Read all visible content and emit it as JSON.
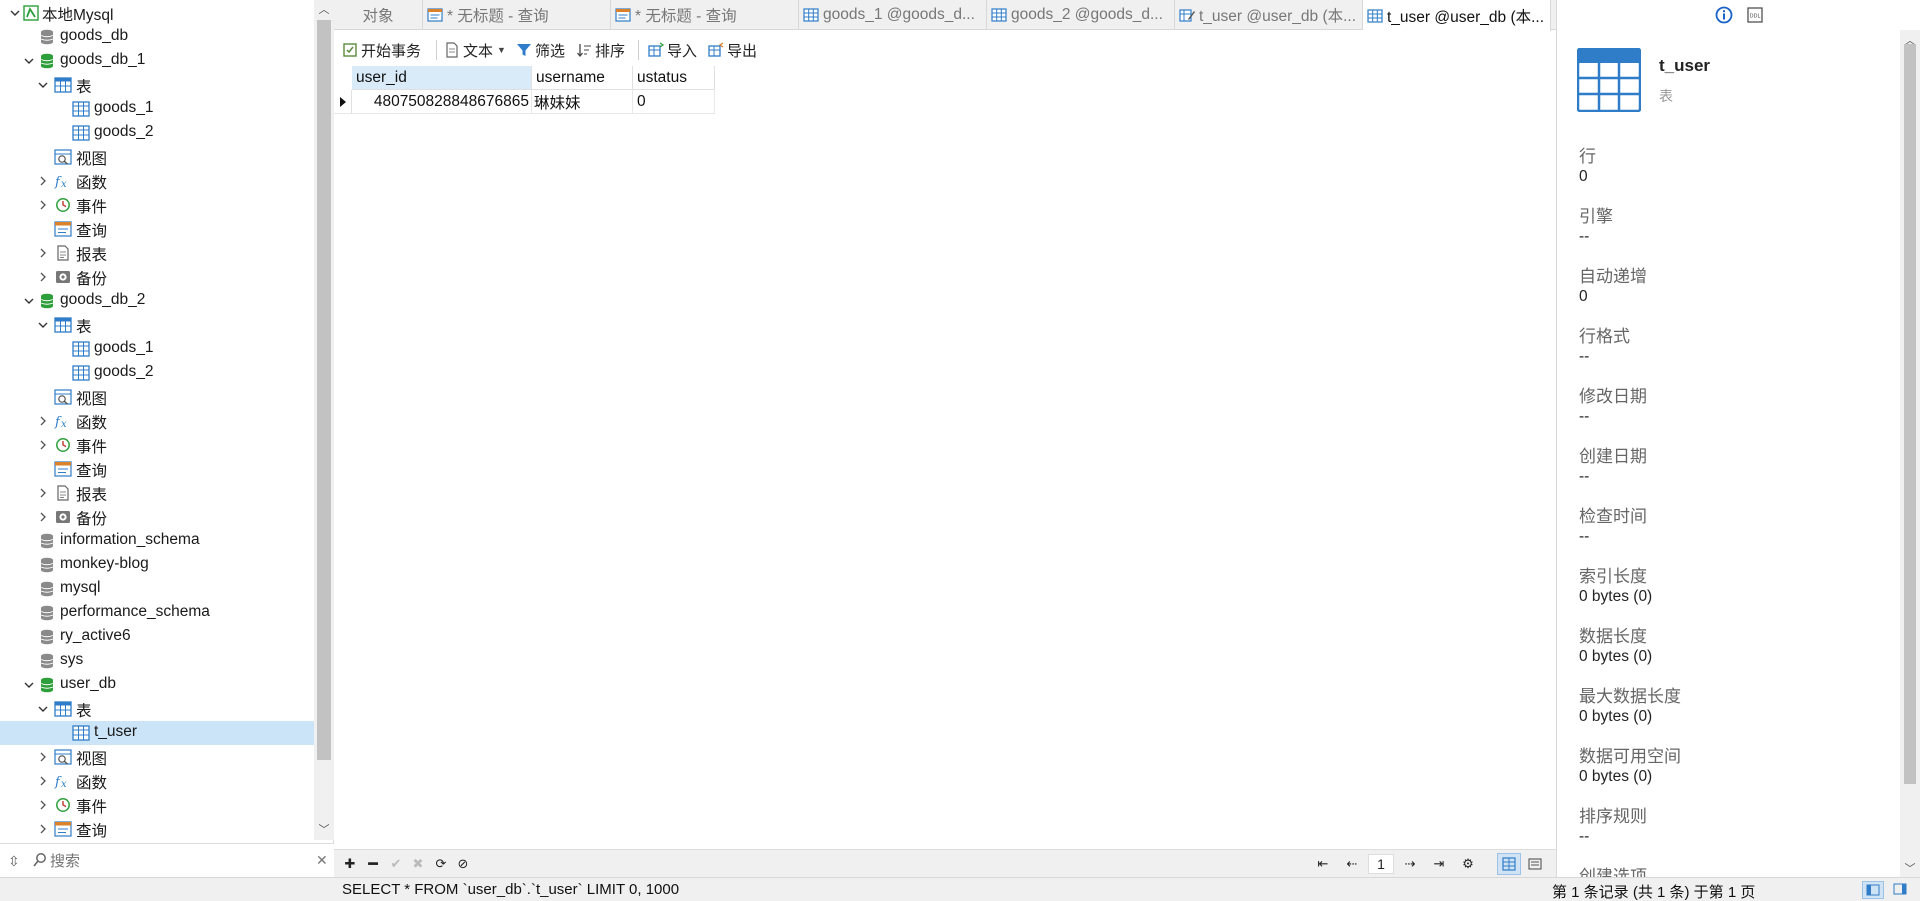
{
  "tree": {
    "nodes": [
      {
        "label": "本地Mysql",
        "level": 0,
        "expanded": true,
        "icon": "connection-icon",
        "chevron": "down"
      },
      {
        "label": "goods_db",
        "level": 1,
        "icon": "database-gray-icon",
        "chevron": "none"
      },
      {
        "label": "goods_db_1",
        "level": 1,
        "icon": "database-green-icon",
        "chevron": "down"
      },
      {
        "label": "表",
        "level": 2,
        "icon": "tables-folder-icon",
        "chevron": "down"
      },
      {
        "label": "goods_1",
        "level": 3,
        "icon": "table-icon",
        "chevron": "none"
      },
      {
        "label": "goods_2",
        "level": 3,
        "icon": "table-icon",
        "chevron": "none"
      },
      {
        "label": "视图",
        "level": 2,
        "icon": "view-icon",
        "chevron": "none"
      },
      {
        "label": "函数",
        "level": 2,
        "icon": "function-icon",
        "chevron": "right"
      },
      {
        "label": "事件",
        "level": 2,
        "icon": "event-icon",
        "chevron": "right"
      },
      {
        "label": "查询",
        "level": 2,
        "icon": "query-icon",
        "chevron": "none"
      },
      {
        "label": "报表",
        "level": 2,
        "icon": "report-icon",
        "chevron": "right"
      },
      {
        "label": "备份",
        "level": 2,
        "icon": "backup-icon",
        "chevron": "right"
      },
      {
        "label": "goods_db_2",
        "level": 1,
        "icon": "database-green-icon",
        "chevron": "down"
      },
      {
        "label": "表",
        "level": 2,
        "icon": "tables-folder-icon",
        "chevron": "down"
      },
      {
        "label": "goods_1",
        "level": 3,
        "icon": "table-icon",
        "chevron": "none"
      },
      {
        "label": "goods_2",
        "level": 3,
        "icon": "table-icon",
        "chevron": "none"
      },
      {
        "label": "视图",
        "level": 2,
        "icon": "view-icon",
        "chevron": "none"
      },
      {
        "label": "函数",
        "level": 2,
        "icon": "function-icon",
        "chevron": "right"
      },
      {
        "label": "事件",
        "level": 2,
        "icon": "event-icon",
        "chevron": "right"
      },
      {
        "label": "查询",
        "level": 2,
        "icon": "query-icon",
        "chevron": "none"
      },
      {
        "label": "报表",
        "level": 2,
        "icon": "report-icon",
        "chevron": "right"
      },
      {
        "label": "备份",
        "level": 2,
        "icon": "backup-icon",
        "chevron": "right"
      },
      {
        "label": "information_schema",
        "level": 1,
        "icon": "database-gray-icon",
        "chevron": "none"
      },
      {
        "label": "monkey-blog",
        "level": 1,
        "icon": "database-gray-icon",
        "chevron": "none"
      },
      {
        "label": "mysql",
        "level": 1,
        "icon": "database-gray-icon",
        "chevron": "none"
      },
      {
        "label": "performance_schema",
        "level": 1,
        "icon": "database-gray-icon",
        "chevron": "none"
      },
      {
        "label": "ry_active6",
        "level": 1,
        "icon": "database-gray-icon",
        "chevron": "none"
      },
      {
        "label": "sys",
        "level": 1,
        "icon": "database-gray-icon",
        "chevron": "none"
      },
      {
        "label": "user_db",
        "level": 1,
        "icon": "database-green-icon",
        "chevron": "down"
      },
      {
        "label": "表",
        "level": 2,
        "icon": "tables-folder-icon",
        "chevron": "down"
      },
      {
        "label": "t_user",
        "level": 3,
        "icon": "table-icon",
        "chevron": "none",
        "selected": true
      },
      {
        "label": "视图",
        "level": 2,
        "icon": "view-icon",
        "chevron": "right"
      },
      {
        "label": "函数",
        "level": 2,
        "icon": "function-icon",
        "chevron": "right"
      },
      {
        "label": "事件",
        "level": 2,
        "icon": "event-icon",
        "chevron": "right"
      },
      {
        "label": "查询",
        "level": 2,
        "icon": "query-icon",
        "chevron": "right"
      }
    ],
    "search_placeholder": "搜索"
  },
  "tabs": [
    {
      "label": "对象",
      "icon": "",
      "active": false
    },
    {
      "label": "* 无标题 - 查询",
      "icon": "query-tab-icon",
      "active": false
    },
    {
      "label": "* 无标题 - 查询",
      "icon": "query-tab-icon",
      "active": false
    },
    {
      "label": "goods_1 @goods_d...",
      "icon": "table-tab-icon",
      "active": false
    },
    {
      "label": "goods_2 @goods_d...",
      "icon": "table-tab-icon",
      "active": false
    },
    {
      "label": "t_user @user_db (本...",
      "icon": "design-tab-icon",
      "active": false
    },
    {
      "label": "t_user @user_db (本...",
      "icon": "table-tab-icon",
      "active": true
    }
  ],
  "toolbar": {
    "begin_transaction": "开始事务",
    "text": "文本",
    "filter": "筛选",
    "sort": "排序",
    "import": "导入",
    "export": "导出"
  },
  "grid": {
    "columns": [
      "user_id",
      "username",
      "ustatus"
    ],
    "rows": [
      [
        "480750828848676865",
        "琳妹妹",
        "0"
      ]
    ]
  },
  "pager": {
    "page": "1"
  },
  "info": {
    "name": "t_user",
    "type": "表",
    "properties": [
      {
        "label": "行",
        "value": "0"
      },
      {
        "label": "引擎",
        "value": "--"
      },
      {
        "label": "自动递增",
        "value": "0"
      },
      {
        "label": "行格式",
        "value": "--"
      },
      {
        "label": "修改日期",
        "value": "--"
      },
      {
        "label": "创建日期",
        "value": "--"
      },
      {
        "label": "检查时间",
        "value": "--"
      },
      {
        "label": "索引长度",
        "value": "0 bytes (0)"
      },
      {
        "label": "数据长度",
        "value": "0 bytes (0)"
      },
      {
        "label": "最大数据长度",
        "value": "0 bytes (0)"
      },
      {
        "label": "数据可用空间",
        "value": "0 bytes (0)"
      },
      {
        "label": "排序规则",
        "value": "--"
      },
      {
        "label": "创建选项",
        "value": ""
      }
    ]
  },
  "status": {
    "sql": "SELECT * FROM `user_db`.`t_user` LIMIT 0, 1000",
    "record": "第 1 条记录 (共 1 条) 于第 1 页"
  },
  "colors": {
    "selection": "#cce4f7",
    "db_green": "#2e9e3a",
    "icon_blue": "#2f7dc8"
  }
}
